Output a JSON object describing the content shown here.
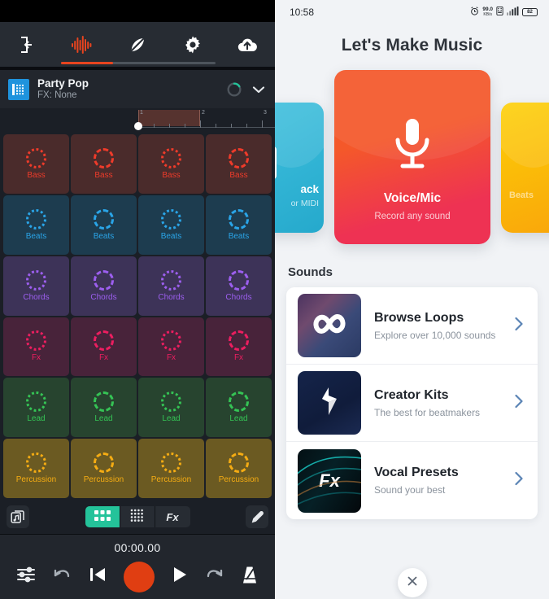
{
  "left": {
    "nav": [
      {
        "id": "exit",
        "icon": "exit-icon",
        "active": false
      },
      {
        "id": "waveform",
        "icon": "waveform-icon",
        "active": true
      },
      {
        "id": "feather",
        "icon": "feather-icon",
        "active": false
      },
      {
        "id": "settings",
        "icon": "gear-icon",
        "active": false
      },
      {
        "id": "upload",
        "icon": "cloud-upload-icon",
        "active": false
      }
    ],
    "track": {
      "name": "Party Pop",
      "fx": "FX: None",
      "icon": "grid-instrument-icon",
      "loading_icon": "loading-spinner-icon",
      "expand_icon": "chevron-down-icon"
    },
    "ruler": {
      "marks": [
        "1",
        "2",
        "3"
      ],
      "loop_start_label": "1",
      "loop_end_label": "2"
    },
    "pads": {
      "rows": [
        {
          "label": "Bass",
          "bg": "#4a2b2b",
          "fg": "#ef3b2a"
        },
        {
          "label": "Beats",
          "bg": "#1d3c4f",
          "fg": "#2aa5e8"
        },
        {
          "label": "Chords",
          "bg": "#3d3358",
          "fg": "#9d5ff0"
        },
        {
          "label": "Fx",
          "bg": "#48233a",
          "fg": "#ed1e60"
        },
        {
          "label": "Lead",
          "bg": "#27442f",
          "fg": "#35c455"
        },
        {
          "label": "Percussion",
          "bg": "#6b5a22",
          "fg": "#f5ac13"
        }
      ],
      "columns": 4
    },
    "mode_bar": {
      "library_icon": "library-music-icon",
      "segments": [
        {
          "id": "pads",
          "icon": "pad-grid-icon",
          "label": "",
          "active": true
        },
        {
          "id": "keys",
          "icon": "dot-grid-icon",
          "label": "",
          "active": false
        },
        {
          "id": "fx",
          "icon": "",
          "label": "Fx",
          "active": false
        }
      ],
      "edit_icon": "pencil-icon"
    },
    "transport": {
      "timecode": "00:00.00",
      "buttons": [
        {
          "id": "mixer",
          "icon": "sliders-icon"
        },
        {
          "id": "undo",
          "icon": "undo-icon"
        },
        {
          "id": "rewind",
          "icon": "skip-to-start-icon"
        },
        {
          "id": "record",
          "icon": "record-icon",
          "color": "#e03e12"
        },
        {
          "id": "play",
          "icon": "play-icon"
        },
        {
          "id": "redo",
          "icon": "redo-icon"
        },
        {
          "id": "metronome",
          "icon": "metronome-icon"
        }
      ]
    }
  },
  "right": {
    "status_bar": {
      "time": "10:58",
      "alarm_icon": "alarm-clock-icon",
      "net_speed_value": "99.0",
      "net_speed_unit": "KB/s",
      "vpn_icon": "vpn-icon",
      "signal_icon": "signal-bars-icon",
      "battery_icon": "battery-icon",
      "battery_level": "82"
    },
    "title": "Let's Make Music",
    "carousel": [
      {
        "id": "track",
        "title": "ack",
        "subtitle": "or MIDI",
        "color_start": "#3fc0de",
        "color_end": "#25a9cc",
        "icon": "guitar-amp-icon"
      },
      {
        "id": "voice-mic",
        "title": "Voice/Mic",
        "subtitle": "Record any sound",
        "color_start": "#f4582a",
        "color_end": "#ee3253",
        "icon": "microphone-icon"
      },
      {
        "id": "beats",
        "title": "Beats",
        "subtitle": "",
        "color_start": "#fdd007",
        "color_end": "#f9a60a",
        "icon": "drum-pad-icon"
      }
    ],
    "sounds_heading": "Sounds",
    "sounds": [
      {
        "title": "Browse Loops",
        "subtitle": "Explore over 10,000 sounds",
        "thumb": "retro-computers-photo",
        "thumb_glyph": "infinity-icon",
        "chevron": "chevron-right-icon"
      },
      {
        "title": "Creator Kits",
        "subtitle": "The best for beatmakers",
        "thumb": "isometric-gear-illustration",
        "thumb_glyph": "paper-plane-icon",
        "chevron": "chevron-right-icon"
      },
      {
        "title": "Vocal Presets",
        "subtitle": "Sound your best",
        "thumb": "teal-light-streaks",
        "thumb_glyph": "Fx",
        "chevron": "chevron-right-icon"
      }
    ],
    "close_button": {
      "icon": "close-x-icon"
    }
  }
}
